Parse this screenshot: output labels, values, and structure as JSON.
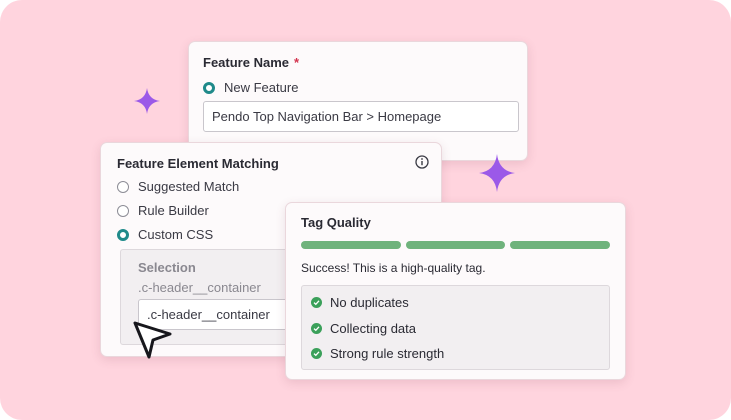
{
  "feature_name_card": {
    "title": "Feature Name",
    "required_mark": "*",
    "option_label": "New Feature",
    "input_value": "Pendo Top Navigation Bar > Homepage"
  },
  "element_matching_card": {
    "title": "Feature Element Matching",
    "info_icon": "info-icon",
    "options": [
      {
        "label": "Suggested Match",
        "selected": false
      },
      {
        "label": "Rule Builder",
        "selected": false
      },
      {
        "label": "Custom CSS",
        "selected": true
      }
    ],
    "selection": {
      "label": "Selection",
      "preview_text": ".c-header__container",
      "input_value": ".c-header__container"
    }
  },
  "tag_quality_card": {
    "title": "Tag Quality",
    "quality_segments": 3,
    "quality_segments_filled": 3,
    "message": "Success! This is a high-quality tag.",
    "checks": [
      {
        "label": "No duplicates"
      },
      {
        "label": "Collecting data"
      },
      {
        "label": "Strong rule strength"
      }
    ]
  },
  "colors": {
    "background": "#ffd4de",
    "accent_teal": "#1f8a8a",
    "success_green": "#3ba05a",
    "quality_bar": "#6fb37c",
    "sparkle": "#9b59e8",
    "required_red": "#d3334e"
  },
  "decorations": [
    "sparkle-icon",
    "sparkle-icon",
    "cursor-pointer-icon"
  ]
}
